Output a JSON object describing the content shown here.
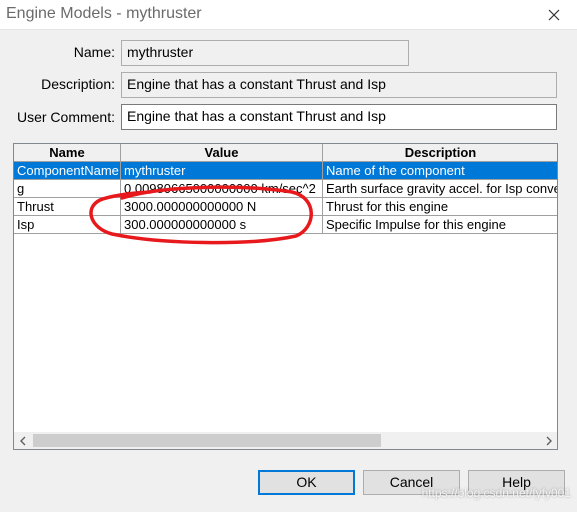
{
  "window": {
    "title": "Engine Models - mythruster"
  },
  "form": {
    "name_label": "Name:",
    "name_value": "mythruster",
    "description_label": "Description:",
    "description_value": "Engine that has a constant Thrust and Isp",
    "comment_label": "User Comment:",
    "comment_value": "Engine that has a constant Thrust and Isp"
  },
  "grid": {
    "columns": [
      "Name",
      "Value",
      "Description"
    ],
    "rows": [
      {
        "name": "ComponentName",
        "value": "mythruster",
        "description": "Name of the component",
        "selected": true
      },
      {
        "name": "g",
        "value": "0.00980665000000000 km/sec^2",
        "description": "Earth surface gravity accel. for Isp conve"
      },
      {
        "name": "Thrust",
        "value": "3000.000000000000 N",
        "description": "Thrust for this engine"
      },
      {
        "name": "Isp",
        "value": "300.000000000000 s",
        "description": "Specific Impulse for this engine"
      }
    ]
  },
  "buttons": {
    "ok": "OK",
    "cancel": "Cancel",
    "help": "Help"
  },
  "watermark": "https://blog.csdn.net/fyfy001",
  "colors": {
    "selection": "#0078d7",
    "annotation": "#e8191c"
  }
}
